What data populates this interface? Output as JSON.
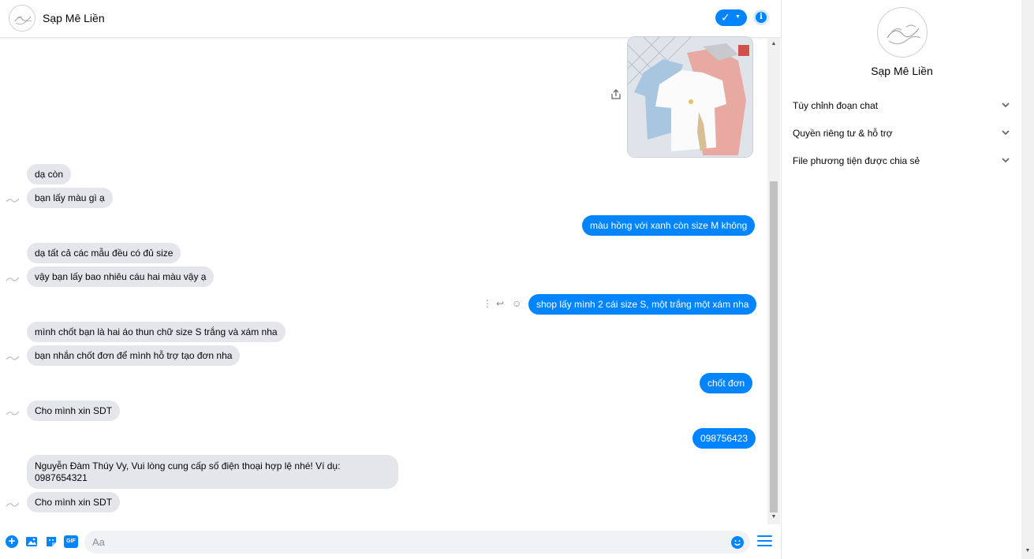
{
  "header": {
    "name": "Sạp Mê Liền"
  },
  "composer": {
    "placeholder": "Aa"
  },
  "messages": {
    "m1": "dạ còn",
    "m2": "bạn lấy màu gì ạ",
    "m3": "màu hồng với xanh còn size M không",
    "m4": "dạ tất cả các mẫu đều có đủ size",
    "m5": "vậy bạn lấy bao nhiêu cáu hai màu vậy ạ",
    "m6": "shop lấy mình 2 cái size S, một trắng một xám nha",
    "m7": "mình chốt bạn là hai áo thun chữ size S trắng và xám nha",
    "m8": "bạn nhắn chốt đơn để mình hỗ trợ tạo đơn nha",
    "m9": "chốt đơn",
    "m10": "Cho mình xin  SDT",
    "m11": "098756423",
    "m12": "Nguyễn Đàm Thúy Vy, Vui lòng cung cấp số điện thoại hợp lệ nhé! Ví dụ: 0987654321",
    "m13": "Cho mình xin  SDT"
  },
  "panel": {
    "name": "Sạp Mê Liền",
    "sections": [
      {
        "label": "Tùy chỉnh đoạn chat"
      },
      {
        "label": "Quyền riêng tư & hỗ trợ"
      },
      {
        "label": "File phương tiện được chia sẻ"
      }
    ]
  },
  "colors": {
    "accent": "#0084ff",
    "incoming_bubble": "#e4e6eb",
    "input_bg": "#f0f2f5"
  },
  "icons": {
    "composer": [
      "plus-circle-icon",
      "photo-icon",
      "sticker-icon",
      "gif-icon",
      "emoji-icon",
      "menu-icon"
    ],
    "header": [
      "check-icon",
      "info-icon"
    ]
  }
}
